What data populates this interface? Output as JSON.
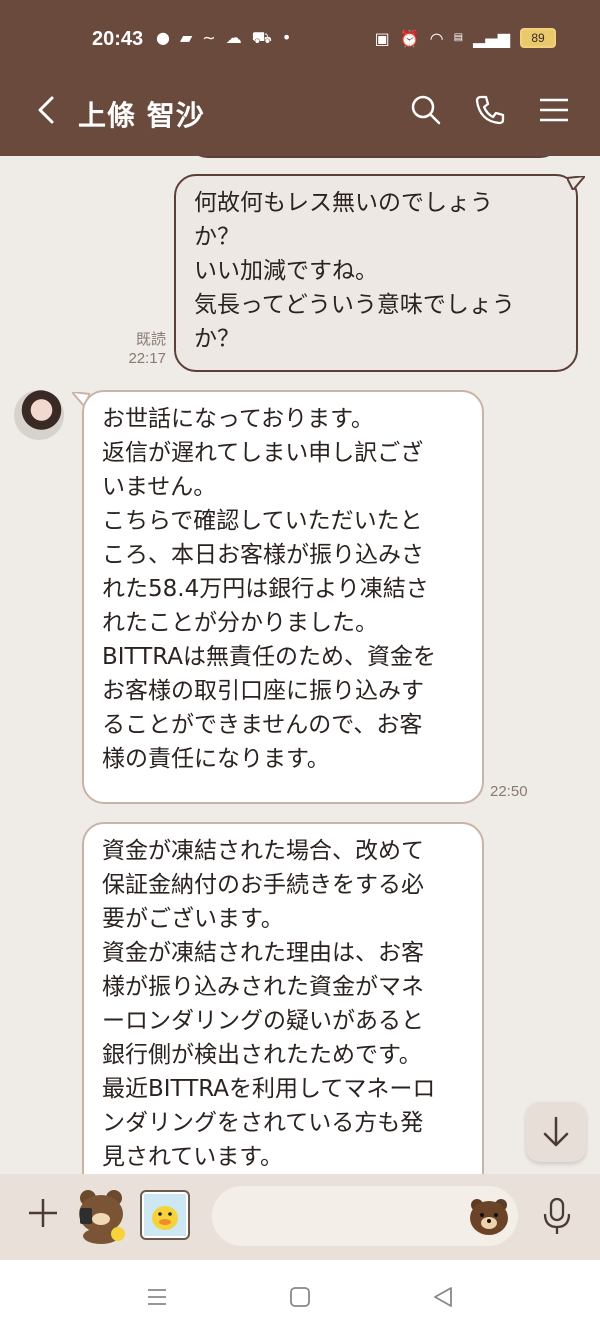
{
  "status_bar": {
    "time": "20:43",
    "left_icons": [
      "chat-bubble-icon",
      "ww-app-icon",
      "tilde-icon",
      "cloud-icon",
      "cart-icon",
      "dot-icon"
    ],
    "right_icons": [
      "nfc-icon",
      "alarm-icon",
      "wifi-icon",
      "volte-icon",
      "signal-icon"
    ],
    "battery": "89"
  },
  "header": {
    "title": "上條 智沙"
  },
  "messages": [
    {
      "direction": "outgoing",
      "text": "何故何もレス無いのでしょう\nか？\nいい加減ですね。\n気長ってどういう意味でしょう\nか？",
      "read_label": "既読",
      "time": "22:17"
    },
    {
      "direction": "incoming",
      "text": "お世話になっております。\n返信が遅れてしまい申し訳ござ\nいません。\nこちらで確認していただいたと\nころ、本日お客様が振り込みさ\nれた58.4万円は銀行より凍結さ\nれたことが分かりました。\nBITTRAは無責任のため、資金を\nお客様の取引口座に振り込みす\nることができませんので、お客\n様の責任になります。",
      "time": "22:50"
    },
    {
      "direction": "incoming",
      "text": "資金が凍結された場合、改めて\n保証金納付のお手続きをする必\n要がございます。\n資金が凍結された理由は、お客\n様が振り込みされた資金がマネ\nーロンダリングの疑いがあると\n銀行側が検出されたためです。\n最近BITTRAを利用してマネーロ\nンダリングをされている方も発\n見されています。"
    }
  ],
  "input_bar": {
    "placeholder": ""
  },
  "colors": {
    "header_bg": "#6b4a3e",
    "chat_bg": "#efebe6",
    "input_bar_bg": "#e9e1d9"
  }
}
